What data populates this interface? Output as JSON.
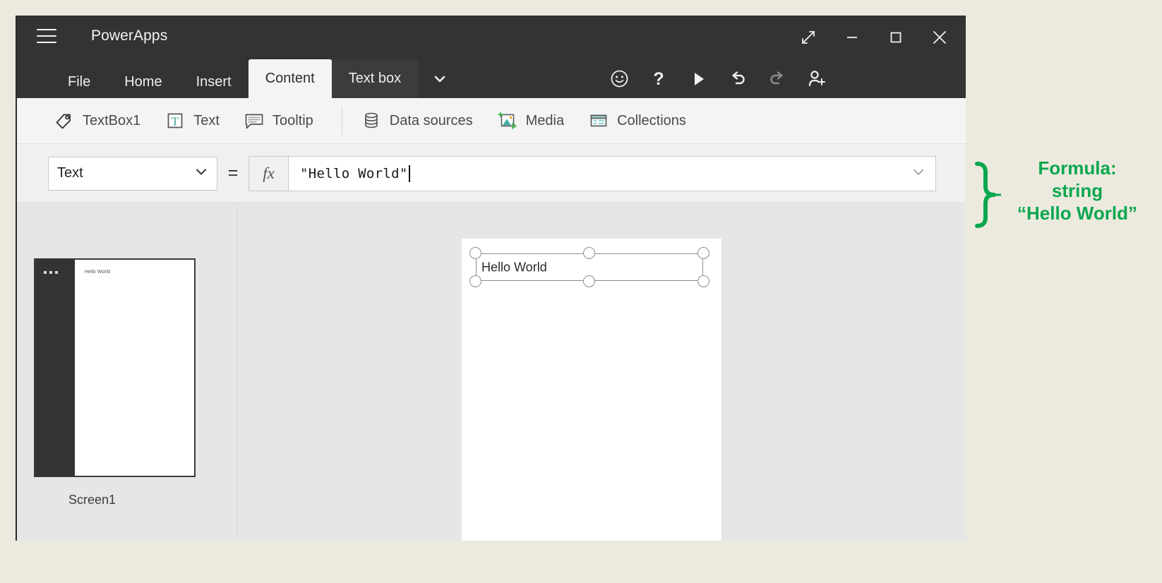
{
  "window": {
    "app_title": "PowerApps",
    "menu_icon": "hamburger-icon",
    "controls": [
      {
        "name": "fullscreen-button",
        "icon": "expand-diagonal-icon"
      },
      {
        "name": "minimize-button",
        "icon": "minimize-icon"
      },
      {
        "name": "maximize-button",
        "icon": "maximize-square-icon"
      },
      {
        "name": "close-button",
        "icon": "close-x-icon"
      }
    ]
  },
  "tabs": {
    "items": [
      {
        "label": "File",
        "active": false
      },
      {
        "label": "Home",
        "active": false
      },
      {
        "label": "Insert",
        "active": false
      },
      {
        "label": "Content",
        "active": true
      },
      {
        "label": "Text box",
        "active": false,
        "group": true
      }
    ],
    "caret_icon": "chevron-down-icon",
    "quick_actions": [
      {
        "name": "feedback-smiley-button",
        "icon": "smiley-icon"
      },
      {
        "name": "help-button",
        "icon": "question-mark-icon"
      },
      {
        "name": "preview-play-button",
        "icon": "play-triangle-icon"
      },
      {
        "name": "undo-button",
        "icon": "undo-arrow-icon"
      },
      {
        "name": "redo-button",
        "icon": "redo-arrow-icon"
      },
      {
        "name": "share-user-button",
        "icon": "person-add-icon"
      }
    ]
  },
  "ribbon": {
    "items": [
      {
        "label": "TextBox1",
        "icon": "tag-icon"
      },
      {
        "label": "Text",
        "icon": "text-t-icon"
      },
      {
        "label": "Tooltip",
        "icon": "speech-bubble-icon"
      },
      {
        "label": "Data sources",
        "icon": "database-icon"
      },
      {
        "label": "Media",
        "icon": "media-image-icon"
      },
      {
        "label": "Collections",
        "icon": "collections-grid-icon"
      }
    ]
  },
  "formula_bar": {
    "property": "Text",
    "property_caret_icon": "chevron-down-icon",
    "equals": "=",
    "fx_label": "fx",
    "value": "\"Hello World\"",
    "expand_caret_icon": "chevron-down-icon"
  },
  "screens": {
    "thumbnail_text": "Hello World",
    "screen_label": "Screen1",
    "overflow_icon": "ellipsis-icon"
  },
  "canvas": {
    "textbox_value": "Hello World",
    "selection_handles": [
      "top-left",
      "top-center",
      "top-right",
      "bottom-left",
      "bottom-center",
      "bottom-right"
    ]
  },
  "annotation": {
    "line1": "Formula:",
    "line2": "string",
    "line3": "“Hello World”",
    "color": "#0ba74f",
    "brace_icon": "curly-brace-icon"
  },
  "colors": {
    "titlebar": "#333333",
    "ribbon": "#f4f4f4",
    "canvas_bg": "#e6e6e6",
    "accent_teal": "#3fa39b",
    "annotation_green": "#0ba74f",
    "page_bg": "#eceade"
  }
}
